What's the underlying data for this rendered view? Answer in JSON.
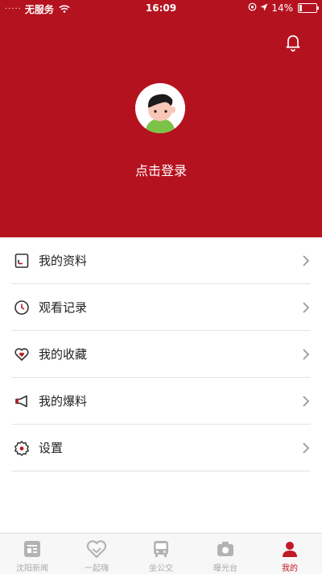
{
  "status_bar": {
    "signal": "·····",
    "carrier": "无服务",
    "time": "16:09",
    "battery": "14%",
    "battery_level": 0.14
  },
  "header": {
    "login_text": "点击登录"
  },
  "menu": {
    "items": [
      {
        "label": "我的资料",
        "icon": "profile-doc-icon"
      },
      {
        "label": "观看记录",
        "icon": "clock-icon"
      },
      {
        "label": "我的收藏",
        "icon": "heart-icon"
      },
      {
        "label": "我的爆料",
        "icon": "megaphone-icon"
      },
      {
        "label": "设置",
        "icon": "gear-icon"
      }
    ]
  },
  "tabbar": {
    "tabs": [
      {
        "label": "沈阳新闻",
        "icon": "news-icon",
        "active": false
      },
      {
        "label": "一起嗨",
        "icon": "heart-hands-icon",
        "active": false
      },
      {
        "label": "坐公交",
        "icon": "bus-icon",
        "active": false
      },
      {
        "label": "曝光台",
        "icon": "camera-icon",
        "active": false
      },
      {
        "label": "我的",
        "icon": "user-icon",
        "active": true
      }
    ]
  },
  "colors": {
    "brand_red": "#b5121f",
    "active_tab": "#c01a26"
  }
}
